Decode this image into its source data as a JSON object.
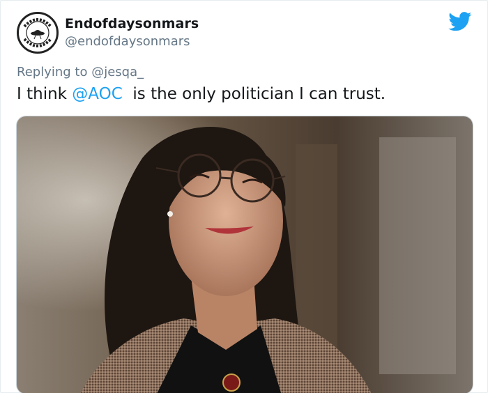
{
  "author": {
    "display_name": "Endofdaysonmars",
    "handle": "@endofdaysonmars",
    "avatar_icon": "ufo-badge-icon",
    "avatar_text": "OF DAYS ON MARS END"
  },
  "reply_context": {
    "prefix": "Replying to ",
    "target": "@jesqa_"
  },
  "tweet": {
    "text_before": "I think ",
    "mention": "@AOC",
    "text_after": "  is the only politician I can trust."
  },
  "brand": {
    "icon": "twitter-bird-icon",
    "accent": "#1da1f2"
  },
  "media": {
    "type": "photo",
    "description_icon": "photo-icon"
  }
}
